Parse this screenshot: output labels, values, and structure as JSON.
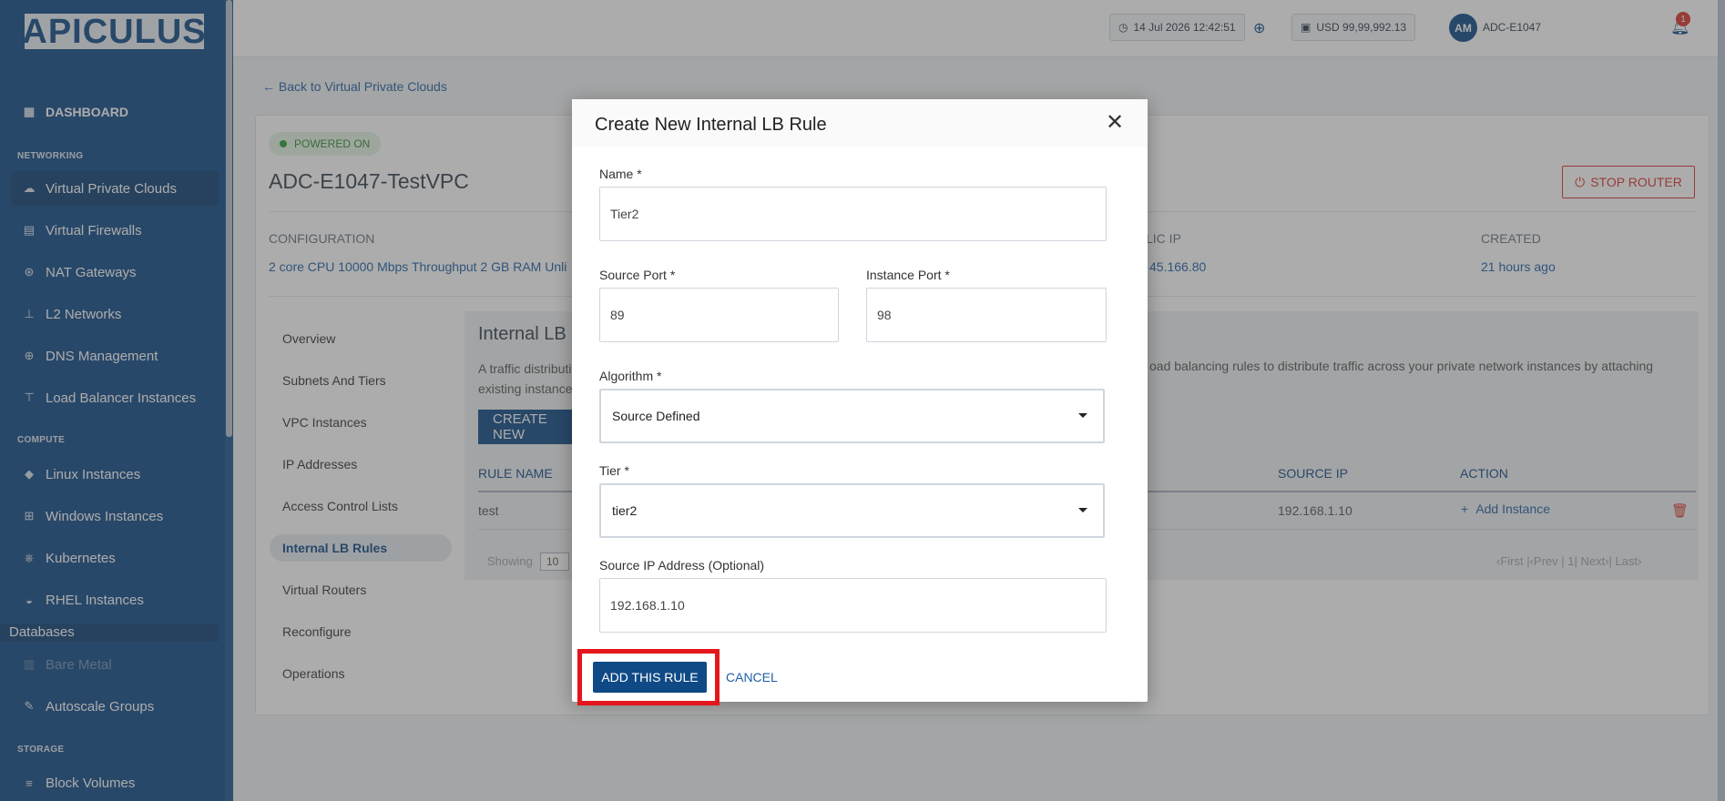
{
  "app": {
    "logo_text": "APICULUS"
  },
  "sidebar": {
    "dashboard": "DASHBOARD",
    "sections": {
      "networking": "NETWORKING",
      "compute": "COMPUTE",
      "storage": "STORAGE"
    },
    "networking_items": [
      {
        "label": "Virtual Private Clouds",
        "icon": "cloud-icon"
      },
      {
        "label": "Virtual Firewalls",
        "icon": "firewall-icon"
      },
      {
        "label": "NAT Gateways",
        "icon": "gateway-icon"
      },
      {
        "label": "L2 Networks",
        "icon": "network-icon"
      },
      {
        "label": "DNS Management",
        "icon": "globe-icon"
      },
      {
        "label": "Load Balancer Instances",
        "icon": "load-balancer-icon"
      }
    ],
    "compute_items": [
      {
        "label": "Linux Instances",
        "icon": "linux-icon"
      },
      {
        "label": "Windows Instances",
        "icon": "windows-icon"
      },
      {
        "label": "Kubernetes",
        "icon": "kubernetes-icon"
      },
      {
        "label": "RHEL Instances",
        "icon": "redhat-icon"
      }
    ],
    "databases_label": "Databases",
    "bare_metal": "Bare Metal",
    "autoscale": "Autoscale Groups",
    "storage_items": [
      {
        "label": "Block Volumes",
        "icon": "volumes-icon"
      }
    ]
  },
  "topbar": {
    "datetime": "14 Jul 2026 12:42:51",
    "balance": "USD 99,99,992.13",
    "avatar_initials": "AM",
    "user_name": "ADC-E1047",
    "notification_count": "1"
  },
  "page": {
    "back_link": "Back to Virtual Private Clouds",
    "status": "POWERED ON",
    "vpc_name": "ADC-E1047-TestVPC",
    "stop_router": "STOP ROUTER",
    "meta": {
      "configuration_label": "CONFIGURATION",
      "configuration_value": "2 core CPU 10000 Mbps Throughput 2 GB RAM Unli",
      "public_ip_label": "LIC IP",
      "public_ip_value": "45.166.80",
      "created_label": "CREATED",
      "created_value": "21 hours ago"
    },
    "sub_nav": [
      "Overview",
      "Subnets And Tiers",
      "VPC Instances",
      "IP Addresses",
      "Access Control Lists",
      "Internal LB Rules",
      "Virtual Routers",
      "Reconfigure",
      "Operations"
    ],
    "content": {
      "title": "Internal LB",
      "desc_line1": "A traffic distributi",
      "desc_line2": "existing instance",
      "desc_right": "oad balancing rules to distribute traffic across your private network instances by attaching",
      "create_button": "CREATE NEW",
      "table": {
        "headers": {
          "rule_name": "RULE NAME",
          "source_ip": "SOURCE IP",
          "action": "ACTION"
        },
        "rows": [
          {
            "rule_name": "test",
            "source_ip": "192.168.1.10",
            "action": "Add Instance"
          }
        ]
      },
      "showing_label": "Showing",
      "page_size": "10",
      "pagination": "‹First  |‹Prev  |  1|  Next›|  Last›"
    }
  },
  "modal": {
    "title": "Create New Internal LB Rule",
    "name_label": "Name *",
    "name_value": "Tier2",
    "source_port_label": "Source Port *",
    "source_port_value": "89",
    "instance_port_label": "Instance Port *",
    "instance_port_value": "98",
    "algorithm_label": "Algorithm *",
    "algorithm_value": "Source Defined",
    "tier_label": "Tier *",
    "tier_value": "tier2",
    "source_ip_label": "Source IP Address (Optional)",
    "source_ip_value": "192.168.1.10",
    "submit_label": "ADD THIS RULE",
    "cancel_label": "CANCEL"
  },
  "colors": {
    "sidebar": "#0f4a86",
    "primary": "#0f4a86",
    "danger": "#d9342b",
    "highlight": "#e3161b"
  }
}
